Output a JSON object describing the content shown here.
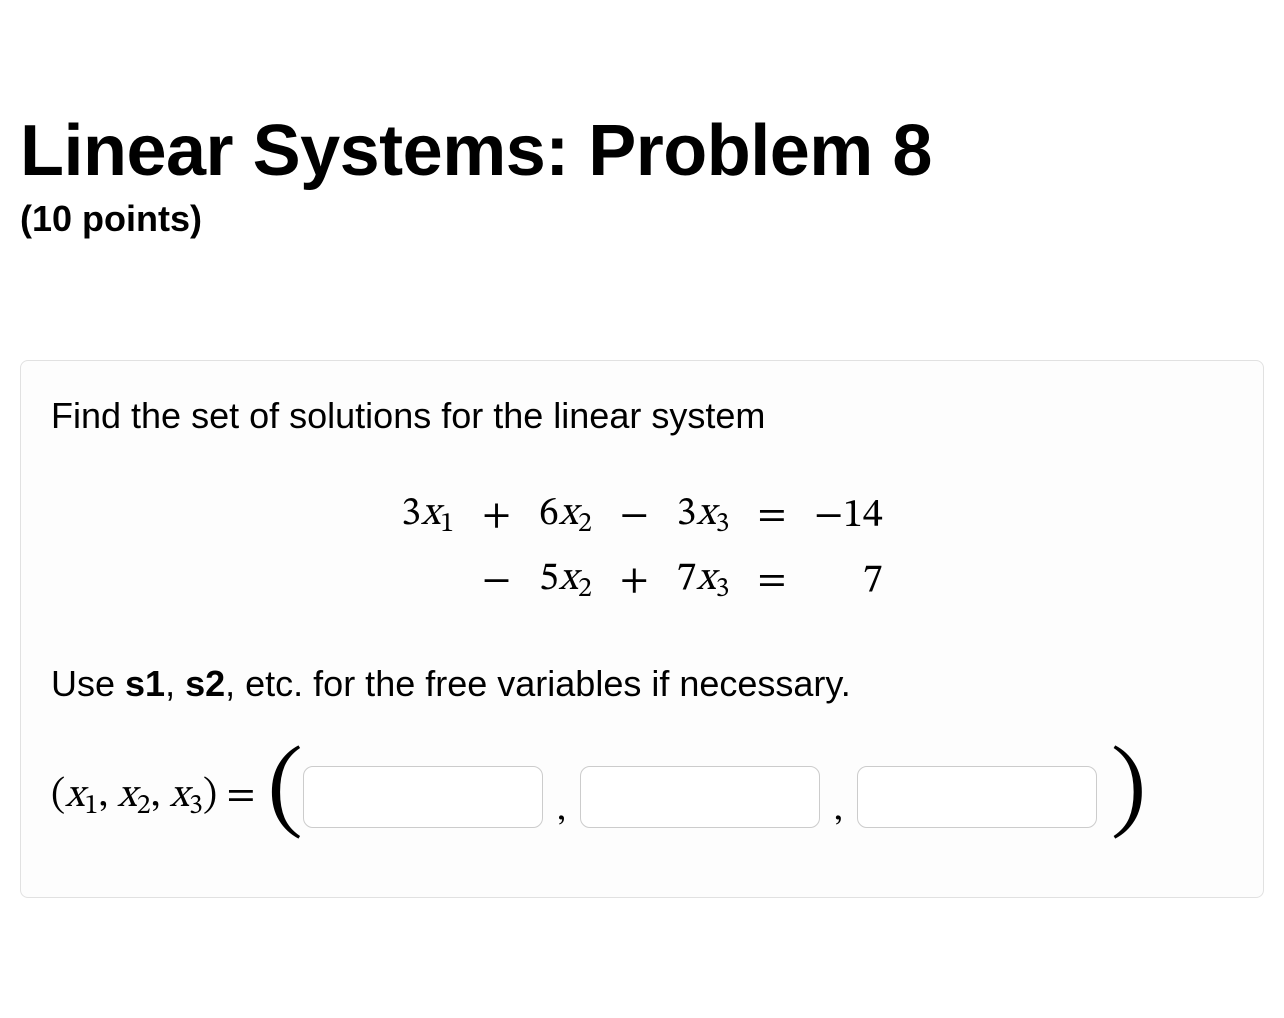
{
  "title": "Linear Systems: Problem 8",
  "points_label": "(10 points)",
  "prompt": "Find the set of solutions for the linear system",
  "equations": {
    "row1": {
      "c1": {
        "coef": "3",
        "var": "x",
        "sub": "1"
      },
      "op1": "+",
      "c2": {
        "coef": "6",
        "var": "x",
        "sub": "2"
      },
      "op2": "−",
      "c3": {
        "coef": "3",
        "var": "x",
        "sub": "3"
      },
      "eq": "=",
      "rhs": "−14"
    },
    "row2": {
      "c1": {
        "coef": "",
        "var": "",
        "sub": ""
      },
      "op1": "−",
      "c2": {
        "coef": "5",
        "var": "x",
        "sub": "2"
      },
      "op2": "+",
      "c3": {
        "coef": "7",
        "var": "x",
        "sub": "3"
      },
      "eq": "=",
      "rhs": "7"
    }
  },
  "hint_prefix": "Use ",
  "hint_s1": "s1",
  "hint_sep": ", ",
  "hint_s2": "s2",
  "hint_suffix": ", etc. for the free variables if necessary.",
  "answer": {
    "lhs_open": "(",
    "v1": {
      "var": "x",
      "sub": "1"
    },
    "comma1": ", ",
    "v2": {
      "var": "x",
      "sub": "2"
    },
    "comma2": ", ",
    "v3": {
      "var": "x",
      "sub": "3"
    },
    "lhs_close": ")",
    "equals": " = ",
    "paren_open": "(",
    "paren_close": ")",
    "sep": ","
  },
  "inputs": {
    "x1": "",
    "x2": "",
    "x3": ""
  }
}
